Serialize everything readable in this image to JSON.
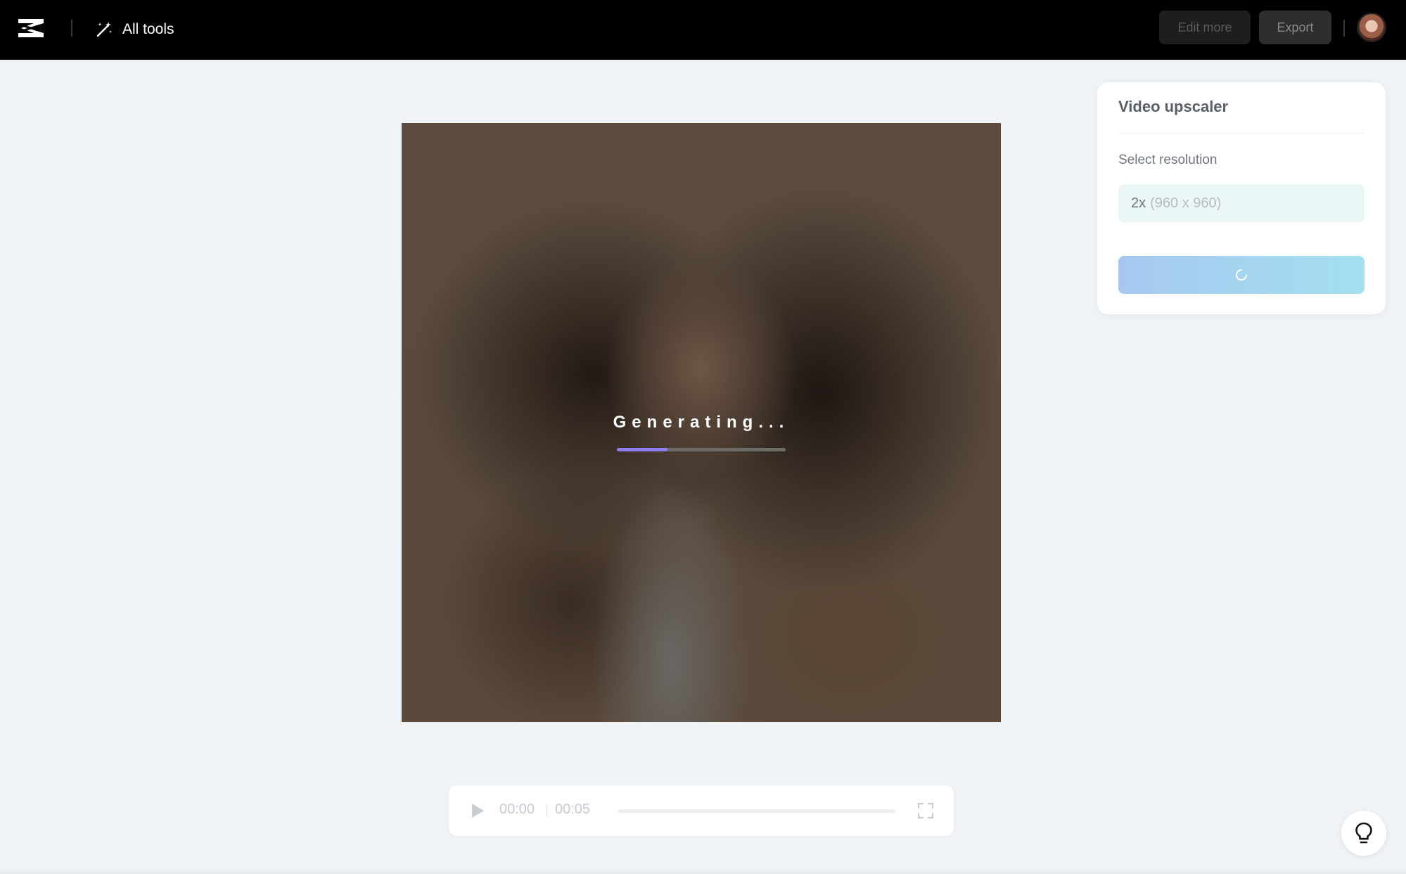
{
  "header": {
    "logo_icon": "capcut-logo-icon",
    "all_tools_label": "All tools",
    "all_tools_icon": "magic-wand-icon",
    "edit_more_label": "Edit more",
    "export_label": "Export",
    "avatar_icon": "user-avatar"
  },
  "preview": {
    "status_text": "Generating...",
    "progress": 0.3,
    "progress_color": "#8e7df0"
  },
  "player": {
    "play_icon": "play-icon",
    "current_time": "00:00",
    "total_time": "00:05",
    "fullscreen_icon": "fullscreen-icon"
  },
  "panel": {
    "title": "Video upscaler",
    "resolution_label": "Select resolution",
    "resolution_value": "2x",
    "resolution_detail": "(960 x 960)",
    "action_state": "loading",
    "action_icon": "spinner-icon"
  },
  "help": {
    "icon": "lightbulb-icon"
  }
}
